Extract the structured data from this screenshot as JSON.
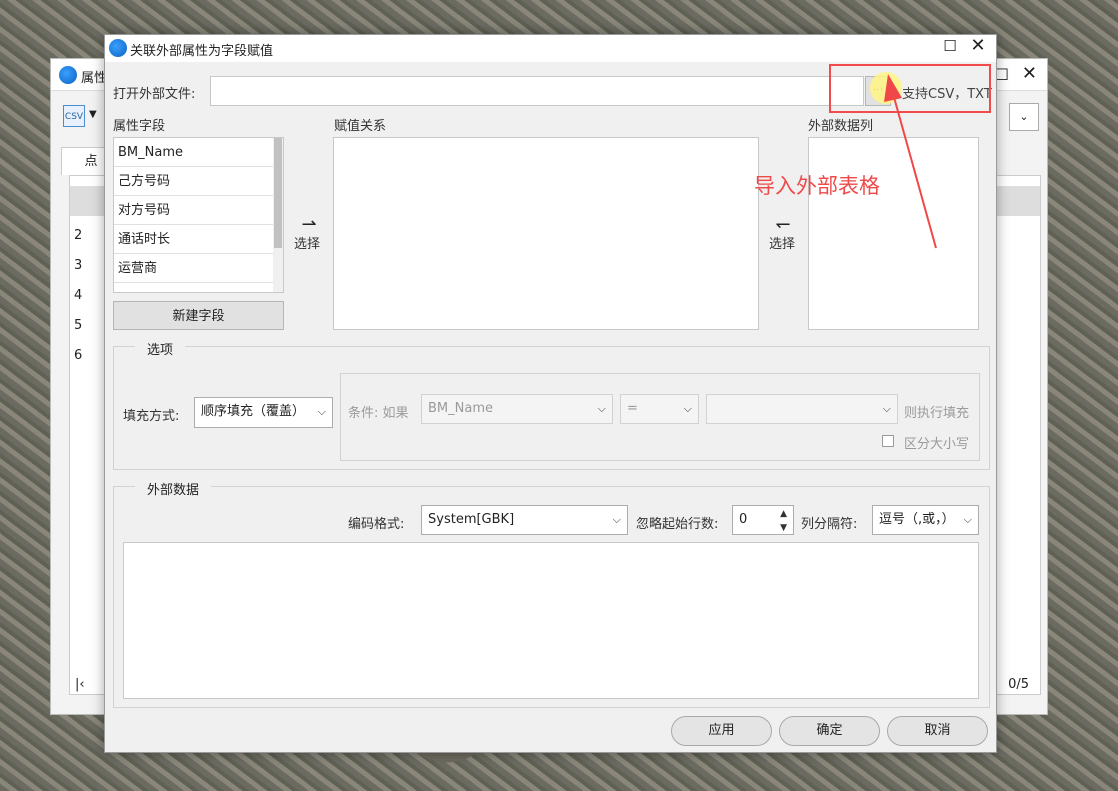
{
  "background_window": {
    "title": "属性",
    "tab": "点",
    "row_numbers": [
      "2",
      "3",
      "4",
      "5",
      "6"
    ],
    "page_indicator": "0/5",
    "toolbar_icon_text": "CSV"
  },
  "dialog": {
    "title": "关联外部属性为字段赋值",
    "open_file_label": "打开外部文件:",
    "open_file_value": "",
    "browse_label": "···",
    "support_hint": "支持CSV，TXT",
    "attr_fields_label": "属性字段",
    "assign_label": "赋值关系",
    "external_cols_label": "外部数据列",
    "fields": [
      "BM_Name",
      "己方号码",
      "对方号码",
      "通话时长",
      "运营商"
    ],
    "new_field_button": "新建字段",
    "select_right": "选择",
    "select_left": "选择",
    "options_group": "选项",
    "fill_mode_label": "填充方式:",
    "fill_mode_value": "顺序填充（覆盖）",
    "condition_label": "条件: 如果",
    "condition_field": "BM_Name",
    "condition_op": "=",
    "condition_value": "",
    "then_fill_label": "则执行填充",
    "case_sensitive_label": "区分大小写",
    "external_group": "外部数据",
    "encoding_label": "编码格式:",
    "encoding_value": "System[GBK]",
    "skip_rows_label": "忽略起始行数:",
    "skip_rows_value": "0",
    "separator_label": "列分隔符:",
    "separator_value": "逗号（,或，）",
    "apply_button": "应用",
    "ok_button": "确定",
    "cancel_button": "取消"
  },
  "annotation": {
    "text": "导入外部表格",
    "color": "#ef4a4a"
  }
}
